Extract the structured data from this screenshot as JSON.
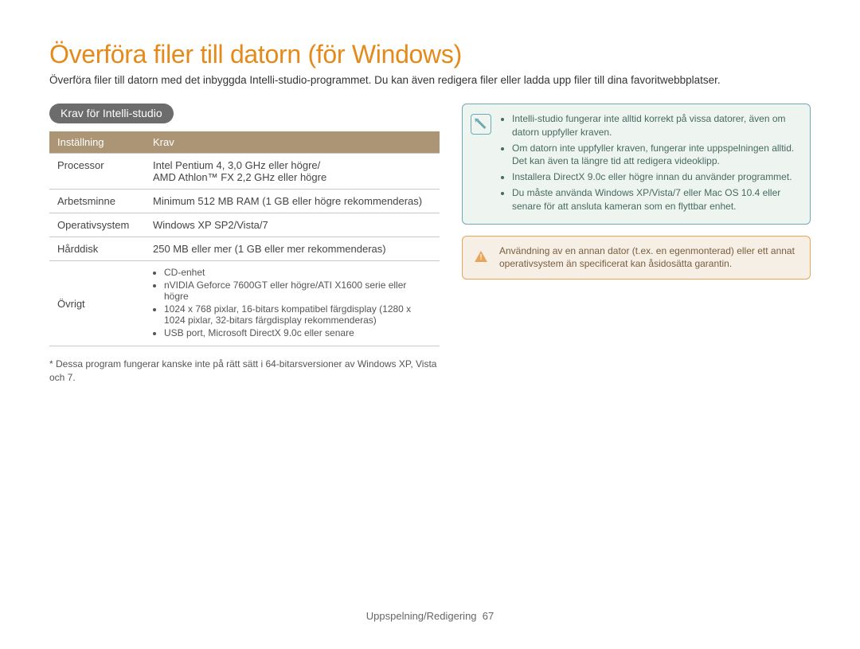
{
  "title": "Överföra filer till datorn (för Windows)",
  "intro": "Överföra filer till datorn med det inbyggda Intelli-studio-programmet. Du kan även redigera filer eller ladda upp filer till dina favoritwebbplatser.",
  "section_tab": "Krav för Intelli-studio",
  "table": {
    "head_setting": "Inställning",
    "head_req": "Krav",
    "rows": {
      "processor_label": "Processor",
      "processor_value": "Intel Pentium 4, 3,0 GHz eller högre/\nAMD Athlon™ FX 2,2 GHz eller högre",
      "ram_label": "Arbetsminne",
      "ram_value": "Minimum 512 MB RAM (1 GB eller högre rekommenderas)",
      "os_label": "Operativsystem",
      "os_value": "Windows XP SP2/Vista/7",
      "hdd_label": "Hårddisk",
      "hdd_value": "250 MB eller mer (1 GB eller mer rekommenderas)",
      "other_label": "Övrigt",
      "other_items": [
        "CD-enhet",
        "nVIDIA Geforce 7600GT eller högre/ATI X1600 serie eller högre",
        "1024 x 768 pixlar, 16-bitars kompatibel färgdisplay (1280 x 1024 pixlar, 32-bitars färgdisplay rekommenderas)",
        "USB port, Microsoft DirectX 9.0c eller senare"
      ]
    }
  },
  "footnote": "* Dessa program fungerar kanske inte på rätt sätt i 64-bitarsversioner av Windows XP, Vista och 7.",
  "info_items": [
    "Intelli-studio fungerar inte alltid korrekt på vissa datorer, även om datorn uppfyller kraven.",
    "Om datorn inte uppfyller kraven, fungerar inte uppspelningen alltid. Det kan även ta längre tid att redigera videoklipp.",
    "Installera DirectX 9.0c eller högre innan du använder programmet.",
    "Du måste använda Windows XP/Vista/7 eller Mac OS 10.4 eller senare för att ansluta kameran som en flyttbar enhet."
  ],
  "warn_text": "Användning av en annan dator (t.ex. en egenmonterad) eller ett annat operativsystem än specificerat kan åsidosätta garantin.",
  "footer_section": "Uppspelning/Redigering",
  "footer_page": "67"
}
